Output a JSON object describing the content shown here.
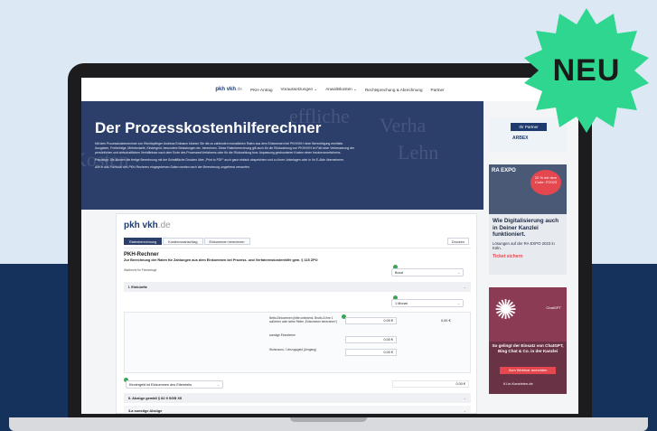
{
  "nav": {
    "logo_main": "pkh vkh",
    "logo_tld": ".de",
    "items": [
      "PKH-Antrag",
      "Voraussetzungen ⌄",
      "Anwaltskosten ⌄",
      "Rechtsprechung & Abrechnung",
      "Partner"
    ]
  },
  "hero": {
    "title": "Der Prozesskostenhilferechner",
    "watermark1": "effliche",
    "watermark2": "Verha",
    "watermark3": "Kosten",
    "watermark4": "Lehn",
    "intro": "Mit dem Prozesskostenrechner von Rechtspfleger Andreas Erdmann können Sie die zu zahlenden monatlichen Raten aus dem Einkommen bei PKH/VKH einer Berechtigung ermitteln. Ausgaben, Freibeträge, Mehrbedarfe, Kindergeld, besondere Belastungen etc. berechnen. Diese Ratenberechnung gilt auch für die Rückzahlung von PKH/VKH im Fall einer Verbesserung der persönlichen und wirtschaftlichen Verhältnisse nach dem Ende des Prozesses/Verfahrens oder für die Rückzahlung bzw. Anpassung gesbundener Kosten einen Insolvenzverfahrens.",
    "tip": "Praxistipp: Sie können die fertige Berechnung mit der Schaltfläche Drucken über „Print to PDF“ auch ganz einfach abspeichern und zu Ihren Unterlagen oder in Ihr E-Akte übernehmen.",
    "note": "Alle in das Formular des PKH-Rechners eingegebenen Daten werden nach der Berechnung umgehend verworfen."
  },
  "ads": {
    "partner_label": "Ihr Partner",
    "partner_name": "ARBEX",
    "expo_title": "RA EXPO",
    "expo_badge": "20 % mit dem Code: IT2023",
    "expo_headline": "Wie Digitalisierung auch in Deiner Kanzlei funktioniert.",
    "expo_sub": "Lösungen auf der RA EXPO 2023 in Köln.",
    "expo_cta": "Ticket sichern",
    "ai_headline": "So gelingt der Einsatz von ChatGPT, Bing Chat & Co. in der Kanzlei",
    "ai_cta": "Zum Webinar anmelden",
    "ai_footer": "KI-in-Kanzleien.de",
    "ai_small": "ChatGPT"
  },
  "calculator": {
    "brand_main": "pkh vkh",
    "brand_tld": ".de",
    "tabs": [
      "Ratenberechnung",
      "Kostenvoranschlag",
      "Einkommen berechnen"
    ],
    "print_label": "Drucken",
    "title": "PKH-Rechner",
    "subtitle": "Zur Berechnung der Raten für Zahlungen aus dem Einkommen bei Prozess- und Verfahrenskostenhilfe gem. § 115 ZPO",
    "partner_label": "Wahlrecht für Partnertage",
    "select1": "Bund",
    "section1": "I. Einkünfte",
    "select2": "1 Monat",
    "field1_label": "Netto-Einkommen (bitte unbedenk. Brutto & ihre 1 außerber oder siehe Reiter „Einkommen berechnen“)",
    "field1_value": "0,00 €",
    "field1_total": "0,00 €",
    "field2_label": "sonstige Einnahmen",
    "field2_value": "0,00 €",
    "field3_label": "Wohnraum- / Umzugsgeld (Umgang)",
    "field3_value": "0,00 €",
    "kindergeld_select": "Kindergeld ist Einkommen des Elternteils",
    "kindergeld_value": "0,00 €",
    "section2": "II. Abzüge gemäß § 82 II SGB XII",
    "section3": "3.a sonstige Abzüge"
  },
  "badge": {
    "label": "NEU"
  },
  "colors": {
    "hero_bg": "#2c3f6b",
    "page_bg_top": "#dce9f5",
    "page_bg_bottom": "#15325c",
    "badge_green": "#2fd68f",
    "accent_red": "#e5474f"
  }
}
